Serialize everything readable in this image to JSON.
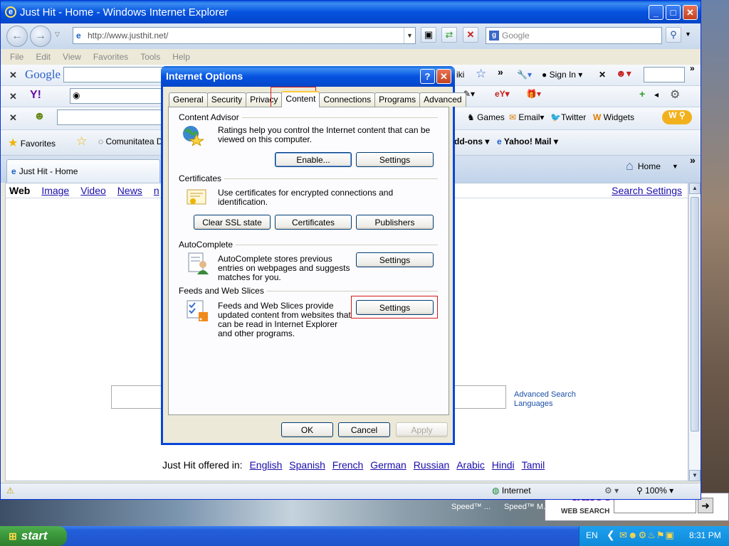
{
  "window": {
    "title": "Just Hit - Home - Windows Internet Explorer",
    "address": "http://www.justhit.net/",
    "search_placeholder": "Google"
  },
  "menu": [
    "File",
    "Edit",
    "View",
    "Favorites",
    "Tools",
    "Help"
  ],
  "toolbars": {
    "google_label": "Google",
    "google_right": "iki",
    "sign_in": "Sign In",
    "yahoo_label": "Y!",
    "games": "Games",
    "email": "Email",
    "twitter": "Twitter",
    "widgets": "Widgets",
    "addons": "dd-ons",
    "yahoo_mail": "Yahoo! Mail"
  },
  "favorites": {
    "favorites_label": "Favorites",
    "comunitatea": "Comunitatea D"
  },
  "tab": {
    "label": "Just Hit - Home",
    "home": "Home"
  },
  "page": {
    "nav": [
      "Web",
      "Image",
      "Video",
      "News",
      "n"
    ],
    "search_settings": "Search Settings",
    "advanced_search": "Advanced Search",
    "languages": "Languages",
    "offered_label": "Just Hit offered in:",
    "offered_languages": [
      "English",
      "Spanish",
      "French",
      "German",
      "Russian",
      "Arabic",
      "Hindi",
      "Tamil"
    ]
  },
  "status": {
    "zone": "Internet",
    "zoom": "100%"
  },
  "dialog": {
    "title": "Internet Options",
    "tabs": [
      "General",
      "Security",
      "Privacy",
      "Content",
      "Connections",
      "Programs",
      "Advanced"
    ],
    "active_tab": "Content",
    "content_advisor": {
      "heading": "Content Advisor",
      "text": "Ratings help you control the Internet content that can be viewed on this computer.",
      "enable": "Enable...",
      "settings": "Settings"
    },
    "certificates": {
      "heading": "Certificates",
      "text": "Use certificates for encrypted connections and identification.",
      "clear_ssl": "Clear SSL state",
      "certificates": "Certificates",
      "publishers": "Publishers"
    },
    "autocomplete": {
      "heading": "AutoComplete",
      "text": "AutoComplete stores previous entries on webpages and suggests matches for you.",
      "settings": "Settings"
    },
    "feeds": {
      "heading": "Feeds and Web Slices",
      "text": "Feeds and Web Slices provide updated content from websites that can be read in Internet Explorer and other programs.",
      "settings": "Settings"
    },
    "ok": "OK",
    "cancel": "Cancel",
    "apply": "Apply"
  },
  "desktop": {
    "speed1": "Speed™ ...",
    "speed2": "Speed™ M.",
    "yahoo_search": "WEB SEARCH",
    "yahoo_logo": "YAHOO!"
  },
  "taskbar": {
    "start": "start",
    "lang": "EN",
    "time": "8:31 PM"
  },
  "colors": {
    "taskbar": "#245edb",
    "start": "#3c9a3c",
    "title": "#0553e0"
  }
}
